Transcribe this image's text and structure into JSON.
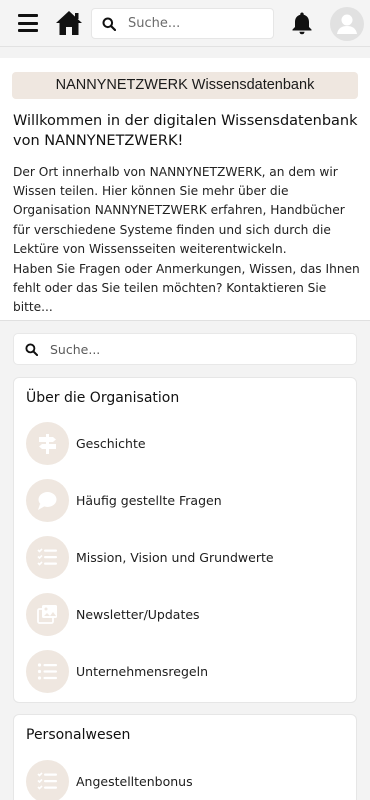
{
  "header": {
    "search_placeholder": "Suche...",
    "icons": [
      "menu-icon",
      "home-icon",
      "search-icon",
      "bell-icon",
      "avatar"
    ]
  },
  "intro": {
    "title": "NANNYNETZWERK Wissensdatenbank",
    "heading": "Willkommen in der digitalen Wissensdatenbank von NANNYNETZWERK!",
    "paragraph1": "Der Ort innerhalb von NANNYNETZWERK, an dem wir Wissen teilen. Hier können Sie mehr über die Organisation NANNYNETZWERK erfahren, Handbücher für verschiedene Systeme finden und sich durch die Lektüre von Wissensseiten weiterentwickeln.",
    "paragraph2": "Haben Sie Fragen oder Anmerkungen, Wissen, das Ihnen fehlt oder das Sie teilen möchten? Kontaktieren Sie bitte..."
  },
  "search": {
    "placeholder": "Suche..."
  },
  "sections": [
    {
      "title": "Über die Organisation",
      "items": [
        {
          "label": "Geschichte",
          "icon": "signpost-icon"
        },
        {
          "label": "Häufig gestellte Fragen",
          "icon": "speech-bubble-icon"
        },
        {
          "label": "Mission, Vision und Grundwerte",
          "icon": "checklist-icon"
        },
        {
          "label": "Newsletter/Updates",
          "icon": "images-icon"
        },
        {
          "label": "Unternehmensregeln",
          "icon": "list-icon"
        }
      ]
    },
    {
      "title": "Personalwesen",
      "items": [
        {
          "label": "Angestelltenbonus",
          "icon": "checklist-icon"
        }
      ]
    }
  ],
  "colors": {
    "accent_beige": "#efe7e0",
    "icon_fill": "#ffffff",
    "page_background": "#f3f3f3"
  }
}
